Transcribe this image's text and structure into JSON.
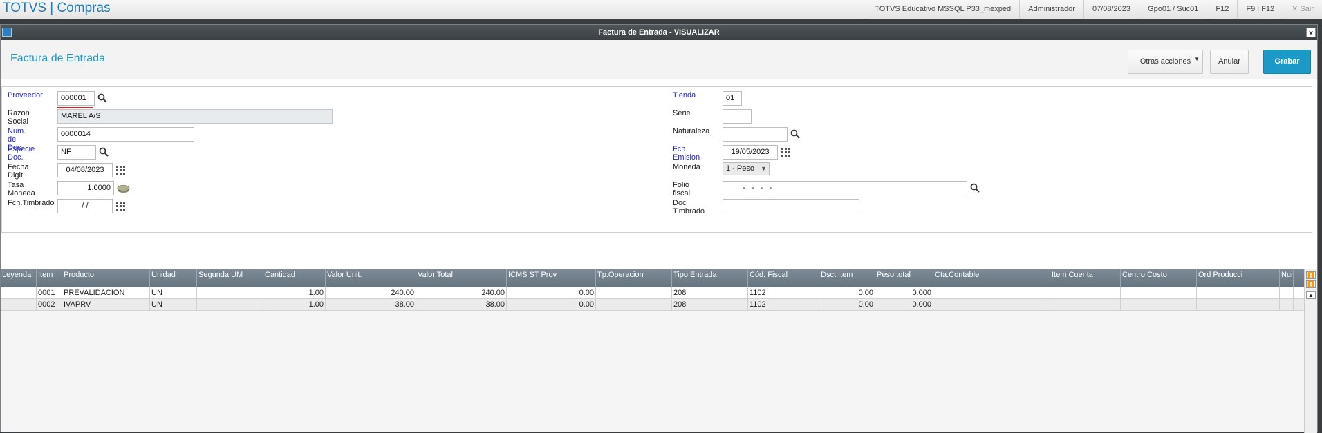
{
  "app": {
    "title": "TOTVS | Compras"
  },
  "topbar": {
    "environment": "TOTVS Educativo MSSQL P33_mexped",
    "user": "Administrador",
    "date": "07/08/2023",
    "branch": "Gpo01 / Suc01",
    "f12": "F12",
    "f9f12": "F9 | F12",
    "exit": "✕  Sair"
  },
  "window": {
    "title": "Factura de Entrada - VISUALIZAR",
    "close": "x"
  },
  "header": {
    "page_title": "Factura de Entrada",
    "other_actions": "Otras acciones",
    "cancel": "Anular",
    "save": "Grabar"
  },
  "form": {
    "proveedor": {
      "label": "Proveedor",
      "value": "000001"
    },
    "razon_social": {
      "label": "Razon Social",
      "value": "MAREL A/S"
    },
    "num_doc": {
      "label": "Num. de Doc.",
      "value": "0000014"
    },
    "especie_doc": {
      "label": "Especie Doc.",
      "value": "NF"
    },
    "fecha_digit": {
      "label": "Fecha Digit.",
      "value": "04/08/2023"
    },
    "tasa_moneda": {
      "label": "Tasa Moneda",
      "value": "1.0000"
    },
    "fch_timbrado": {
      "label": "Fch.Timbrado",
      "value": "/  /"
    },
    "tienda": {
      "label": "Tienda",
      "value": "01"
    },
    "serie": {
      "label": "Serie",
      "value": ""
    },
    "naturaleza": {
      "label": "Naturaleza",
      "value": ""
    },
    "fch_emision": {
      "label": "Fch Emision",
      "value": "19/05/2023"
    },
    "moneda": {
      "label": "Moneda",
      "value": "1 - Peso"
    },
    "folio_fiscal": {
      "label": "Folio fiscal",
      "value": "-   -   -   -"
    },
    "doc_timbrado": {
      "label": "Doc Timbrado",
      "value": ""
    }
  },
  "grid": {
    "columns": [
      "Leyenda",
      "Item",
      "Producto",
      "Unidad",
      "Segunda UM",
      "Cantidad",
      "Valor Unit.",
      "Valor Total",
      "ICMS ST Prov",
      "Tp.Operacion",
      "Tipo Entrada",
      "Cód. Fiscal",
      "Dsct.Item",
      "Peso total",
      "Cta.Contable",
      "Item Cuenta",
      "Centro Costo",
      "Ord Producci",
      "Num."
    ],
    "rows": [
      [
        "",
        "0001",
        "PREVALIDACION",
        "UN",
        "",
        "1.00",
        "240.00",
        "240.00",
        "0.00",
        "",
        "208",
        "1102",
        "0.00",
        "0.000",
        "",
        "",
        "",
        "",
        ""
      ],
      [
        "",
        "0002",
        "IVAPRV",
        "UN",
        "",
        "1.00",
        "38.00",
        "38.00",
        "0.00",
        "",
        "208",
        "1102",
        "0.00",
        "0.000",
        "",
        "",
        "",
        "",
        ""
      ]
    ]
  },
  "colors": {
    "accent": "#1b9ac8",
    "required_label": "#2222cc",
    "grid_header": "#6f7d88"
  }
}
